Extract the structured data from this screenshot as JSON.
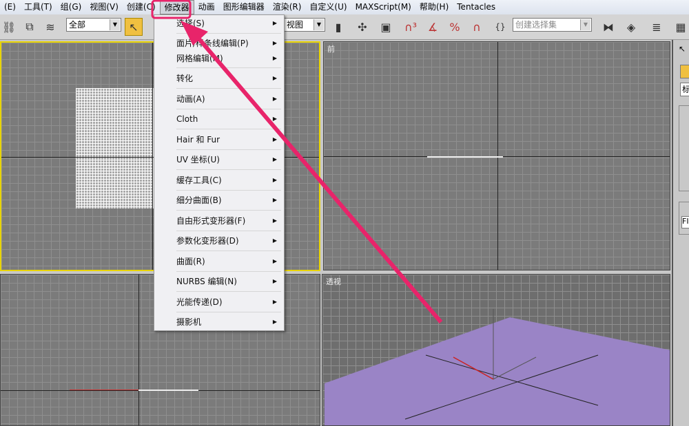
{
  "menubar": {
    "items": [
      "(E)",
      "工具(T)",
      "组(G)",
      "视图(V)",
      "创建(C)",
      "修改器",
      "动画",
      "图形编辑器",
      "渲染(R)",
      "自定义(U)",
      "MAXScript(M)",
      "帮助(H)",
      "Tentacles"
    ],
    "active": "修改器"
  },
  "toolbar": {
    "selection_filter": "全部",
    "view_dropdown": "视图",
    "named_selection_placeholder": "创建选择集",
    "tool_icons": [
      "link-icon",
      "unlink-icon",
      "bind-space-warp-icon",
      "select-icon",
      "move-icon",
      "viewport-icon",
      "snap-3-icon",
      "angle-snap-icon",
      "percent-snap-icon",
      "spinner-snap-icon",
      "edit-named-selection-icon",
      "mirror-icon",
      "align-icon",
      "layers-icon",
      "schematic-icon"
    ]
  },
  "viewports": {
    "top_left": {
      "label": ""
    },
    "front": {
      "label": "前"
    },
    "bottom_left": {
      "label": ""
    },
    "perspective": {
      "label": "透视",
      "plane_color": "#9a84c6"
    }
  },
  "modifier_menu": {
    "items": [
      "选择(S)",
      "面片/样条线编辑(P)",
      "网格编辑(M)",
      "转化",
      "动画(A)",
      "Cloth",
      "Hair 和 Fur",
      "UV 坐标(U)",
      "缓存工具(C)",
      "细分曲面(B)",
      "自由形式变形器(F)",
      "参数化变形器(D)",
      "曲面(R)",
      "NURBS 编辑(N)",
      "光能传递(D)",
      "摄影机"
    ]
  },
  "right_panel": {
    "dropdown_text": "标",
    "field_text": "FI"
  },
  "annotation": {
    "color": "#e8246a"
  },
  "colors": {
    "active_viewport_border": "#e8d400",
    "selected_tool": "#f0c040"
  }
}
